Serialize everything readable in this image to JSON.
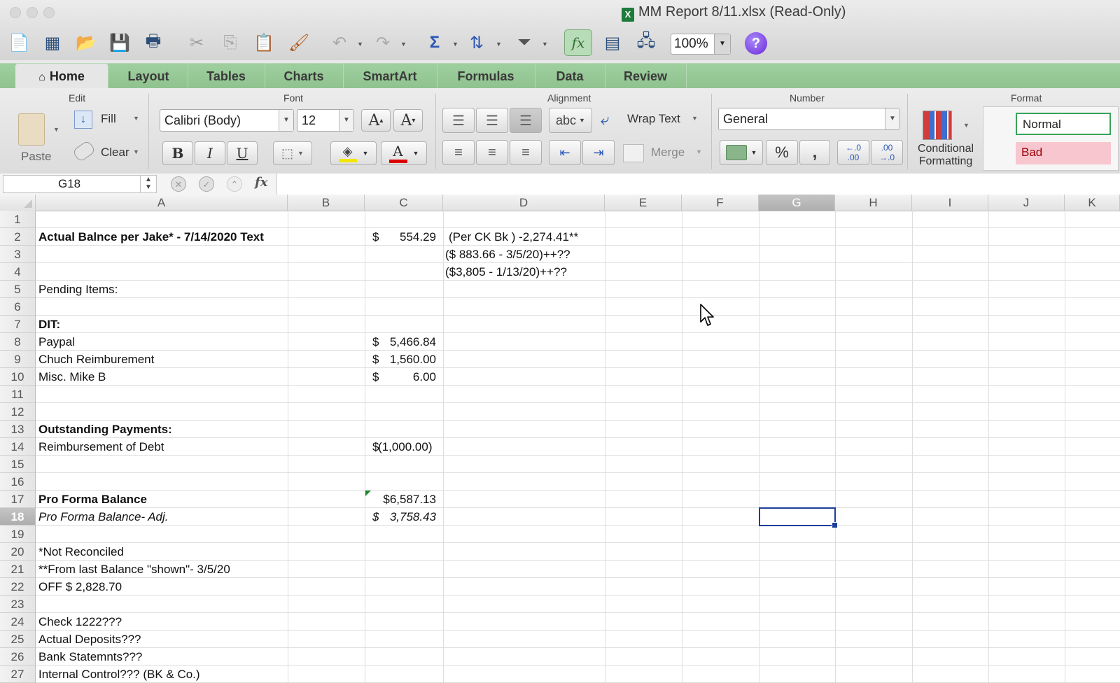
{
  "window": {
    "title": "MM Report 8/11.xlsx  (Read-Only)",
    "app_icon": "excel-file-icon"
  },
  "toolbar": {
    "zoom": "100%",
    "icons": [
      "new-workbook-icon",
      "templates-icon",
      "open-icon",
      "save-icon",
      "print-icon",
      "cut-icon",
      "copy-icon",
      "paste-icon",
      "format-painter-icon",
      "undo-icon",
      "redo-icon",
      "autosum-icon",
      "sort-icon",
      "filter-icon",
      "function-icon",
      "gallery-icon",
      "toolbox-icon",
      "help-icon"
    ]
  },
  "ribbon_tabs": [
    {
      "label": "Home",
      "active": true
    },
    {
      "label": "Layout"
    },
    {
      "label": "Tables"
    },
    {
      "label": "Charts"
    },
    {
      "label": "SmartArt"
    },
    {
      "label": "Formulas"
    },
    {
      "label": "Data"
    },
    {
      "label": "Review"
    }
  ],
  "ribbon": {
    "groups": {
      "edit": "Edit",
      "font": "Font",
      "alignment": "Alignment",
      "number": "Number",
      "format": "Format"
    },
    "paste_label": "Paste",
    "fill_label": "Fill",
    "clear_label": "Clear",
    "font_name": "Calibri (Body)",
    "font_size": "12",
    "wrap_text_label": "Wrap Text",
    "merge_label": "Merge",
    "abc_label": "abc",
    "number_format": "General",
    "percent_label": "%",
    "comma_label": ",",
    "conditional_formatting_label": "Conditional Formatting",
    "styles": [
      {
        "label": "Normal",
        "bg": "#ffffff",
        "border": "#3aa35a",
        "color": "#222222"
      },
      {
        "label": "Bad",
        "bg": "#f7c6ce",
        "border": "#f7c6ce",
        "color": "#9c0006"
      }
    ]
  },
  "formula_bar": {
    "name_box": "G18",
    "fx_label": "fx",
    "formula": ""
  },
  "sheet": {
    "columns": [
      "A",
      "B",
      "C",
      "D",
      "E",
      "F",
      "G",
      "H",
      "I",
      "J",
      "K"
    ],
    "selected_column": "G",
    "rows_visible": [
      "1",
      "2",
      "3",
      "4",
      "5",
      "6",
      "7",
      "8",
      "9",
      "10",
      "11",
      "12",
      "13",
      "14",
      "15",
      "16",
      "17",
      "18",
      "19",
      "20",
      "21",
      "22",
      "23",
      "24",
      "25",
      "26",
      "27"
    ],
    "selected_row": "18",
    "cells": {
      "A2": "Actual Balnce per Jake* - 7/14/2020 Text",
      "C2": {
        "sym": "$",
        "num": "554.29"
      },
      "D2": "(Per CK Bk ) -2,274.41**",
      "D3": "($ 883.66 - 3/5/20)++??",
      "D4": "($3,805 - 1/13/20)++??",
      "A5": "Pending Items:",
      "A7": "DIT:",
      "A8": "Paypal",
      "C8": {
        "sym": "$",
        "num": "5,466.84"
      },
      "A9": "Chuch Reimburement",
      "C9": {
        "sym": "$",
        "num": "1,560.00"
      },
      "A10": "Misc. Mike B",
      "C10": {
        "sym": "$",
        "num": "6.00"
      },
      "A13": "Outstanding Payments:",
      "A14": "Reimbursement of Debt",
      "C14": {
        "sym": "$",
        "num": "(1,000.00)"
      },
      "A17": "Pro Forma Balance",
      "C17": "$6,587.13",
      "A18": "Pro Forma Balance- Adj.",
      "C18": {
        "sym": "$",
        "num": "3,758.43"
      },
      "A20": "*Not Reconciled",
      "A21": "**From last Balance \"shown\"- 3/5/20",
      "A22": "OFF $ 2,828.70",
      "A24": "Check 1222???",
      "A25": "Actual Deposits???",
      "A26": "Bank Statemnts???",
      "A27": "Internal Control??? (BK & Co.)"
    }
  }
}
